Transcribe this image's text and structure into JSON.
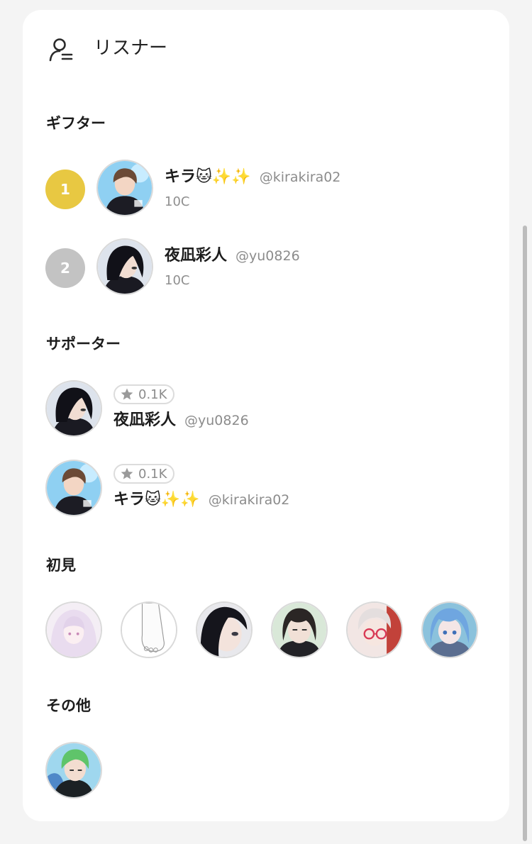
{
  "header": {
    "title": "リスナー",
    "icon": "listener-icon"
  },
  "sections": {
    "gifters": {
      "title": "ギフター"
    },
    "supporters": {
      "title": "サポーター"
    },
    "first_time": {
      "title": "初見"
    },
    "others": {
      "title": "その他"
    }
  },
  "gifters": [
    {
      "rank": "1",
      "name": "キラ🐱✨✨",
      "handle": "@kirakira02",
      "coins": "10C"
    },
    {
      "rank": "2",
      "name": "夜凪彩人",
      "handle": "@yu0826",
      "coins": "10C"
    }
  ],
  "supporters": [
    {
      "points": "0.1K",
      "name": "夜凪彩人",
      "handle": "@yu0826"
    },
    {
      "points": "0.1K",
      "name": "キラ🐱✨✨",
      "handle": "@kirakira02"
    }
  ],
  "colors": {
    "rank_gold": "#e8c842",
    "rank_silver": "#c3c3c3",
    "background": "#f4f4f4",
    "card": "#ffffff"
  }
}
